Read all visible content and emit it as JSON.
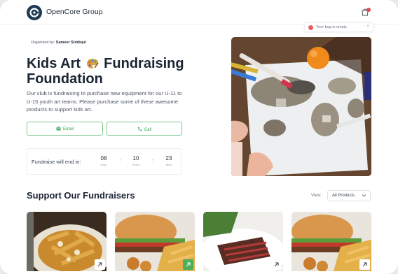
{
  "header": {
    "brand_name": "OpenCore Group",
    "bag_icon": "shopping-bag-icon",
    "toast_text": "Your bag is empty."
  },
  "hero": {
    "organizer_prefix": "Organized by:",
    "organizer_name": "Sameer Siddiqui",
    "title_part1": "Kids Art",
    "title_part2": "Fundraising Foundation",
    "title_icon": "artist-palette-icon",
    "description": "Our club is fundraising to purchase new equipment for our U-11 to U-15 youth art teams. Please purchase some of these awesome products to support kids art.",
    "email_label": "Email",
    "call_label": "Call",
    "timer": {
      "label": "Fundraise will end in:",
      "days": "08",
      "days_label": "Days",
      "hours": "10",
      "hours_label": "Hours",
      "mins": "23",
      "mins_label": "Mins",
      "separator": ":"
    }
  },
  "products": {
    "section_title": "Support Our Fundraisers",
    "view_label": "View:",
    "view_selected": "All Products",
    "cards": [
      {
        "image": "poutine-fries-photo"
      },
      {
        "image": "burger-and-fries-photo"
      },
      {
        "image": "sliced-steak-photo"
      },
      {
        "image": "burger-and-fries-photo"
      }
    ]
  },
  "colors": {
    "accent_green": "#4cae5a",
    "brand_navy": "#1e3a52",
    "alert_red": "#e5484d"
  }
}
